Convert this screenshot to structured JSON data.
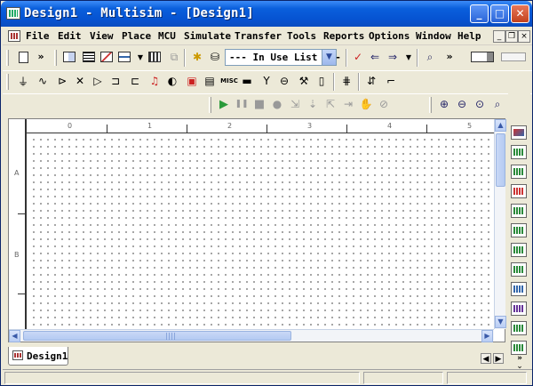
{
  "window": {
    "title": "Design1 - Multisim - [Design1]",
    "buttons": {
      "minimize": "_",
      "maximize": "□",
      "close": "✕"
    }
  },
  "menubar": {
    "items": [
      "File",
      "Edit",
      "View",
      "Place",
      "MCU",
      "Simulate",
      "Transfer",
      "Tools",
      "Reports",
      "Options",
      "Window",
      "Help"
    ],
    "mdi_buttons": {
      "minimize": "_",
      "restore": "❐",
      "close": "×"
    }
  },
  "toolbar": {
    "in_use_list": "--- In Use List ---",
    "dropdown_arrow": "▼"
  },
  "components_toolbar": {
    "misc_label": "MISC"
  },
  "simulate_toolbar": {
    "run": "▶",
    "pause": "❚❚",
    "stop": "■"
  },
  "tabs": [
    {
      "label": "Design1"
    }
  ],
  "ruler": {
    "top_labels": [
      "0",
      "1",
      "2",
      "3",
      "4",
      "5"
    ],
    "left_labels": [
      "A",
      "B"
    ]
  },
  "scrollbars": {
    "up": "▲",
    "down": "▼",
    "left": "◀",
    "right": "▶"
  },
  "tab_nav": {
    "prev": "◀",
    "next": "▶",
    "more": "»"
  }
}
